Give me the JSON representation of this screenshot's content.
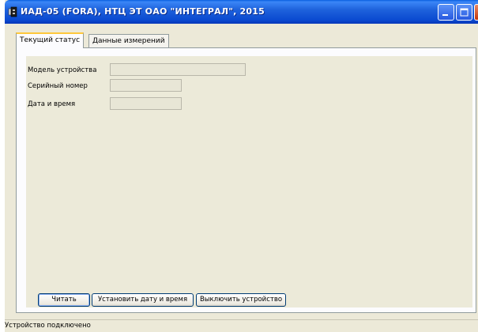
{
  "window": {
    "title": "ИАД-05 (FORA), НТЦ ЭТ ОАО \"ИНТЕГРАЛ\", 2015"
  },
  "tabs": [
    {
      "label": "Текущий статус",
      "active": true
    },
    {
      "label": "Данные измерений",
      "active": false
    }
  ],
  "fields": {
    "device_model": {
      "label": "Модель устройства",
      "value": ""
    },
    "serial_number": {
      "label": "Серийный номер",
      "value": ""
    },
    "date_time": {
      "label": "Дата и время",
      "value": ""
    }
  },
  "buttons": {
    "read": "Читать",
    "set_datetime": "Установить дату и время",
    "power_off": "Выключить устройство"
  },
  "statusbar": {
    "text": "Устройство подключено"
  },
  "icons": {
    "app": "usb-plug-icon",
    "minimize": "minimize-icon",
    "maximize": "maximize-icon",
    "close": "close-icon"
  },
  "colors": {
    "titlebar": "#0a49d0",
    "face": "#ece9d8",
    "close_button": "#c2350b"
  }
}
